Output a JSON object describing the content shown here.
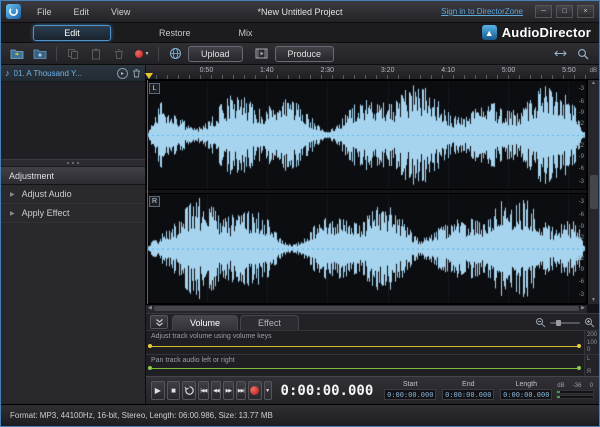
{
  "titlebar": {
    "menus": [
      "File",
      "Edit",
      "View"
    ],
    "title": "*New Untitled Project",
    "signin": "Sign in to DirectorZone"
  },
  "modes": {
    "edit": "Edit",
    "restore": "Restore",
    "mix": "Mix",
    "brand": "AudioDirector"
  },
  "toolbar": {
    "upload": "Upload",
    "produce": "Produce"
  },
  "library": {
    "track_label": "01. A Thousand Y..."
  },
  "adjustment": {
    "header": "Adjustment",
    "items": [
      {
        "label": "Adjust Audio"
      },
      {
        "label": "Apply Effect"
      }
    ]
  },
  "timeline": {
    "ticks": [
      "0:50",
      "1:40",
      "2:30",
      "3:20",
      "4:10",
      "5:00",
      "5:50"
    ],
    "db_unit": "dB",
    "channels": [
      {
        "label": "L"
      },
      {
        "label": "R"
      }
    ],
    "db_scale": [
      "-3",
      "-6",
      "-9",
      "-12",
      "-12",
      "-9",
      "-6",
      "-3"
    ]
  },
  "keyframe_panel": {
    "tabs": [
      {
        "label": "Volume"
      },
      {
        "label": "Effect"
      }
    ],
    "volume_hint": "Adjust track volume using volume keys",
    "pan_hint": "Pan track audio left or right",
    "volume_scale": [
      "200",
      "100",
      "0"
    ],
    "pan_scale": [
      "L",
      "R"
    ]
  },
  "transport": {
    "time": "0:00:00.000",
    "fields": [
      {
        "label": "Start",
        "value": "0:00:00.000"
      },
      {
        "label": "End",
        "value": "0:00:00.000"
      },
      {
        "label": "Length",
        "value": "0:00:00.000"
      }
    ],
    "meter": {
      "unit": "dB",
      "ticks": [
        "-36",
        "0"
      ]
    }
  },
  "statusbar": {
    "text": "Format: MP3, 44100Hz, 16-bit, Stereo, Length: 06:00.986, Size: 13.77 MB"
  },
  "icons": {
    "minimize": "─",
    "maximize": "□",
    "close": "×",
    "dropdown": "▼",
    "up_arrow": "▲",
    "note": "♪",
    "expand_arrow": "▶",
    "play": "▶",
    "stop": "■",
    "seek_start": "|◀◀",
    "rewind": "◀◀",
    "forward": "▶▶",
    "seek_end": "▶▶|",
    "scroll_up": "▲",
    "scroll_down": "▼",
    "scroll_left": "◀",
    "scroll_right": "▶",
    "track_badge": "▸"
  },
  "colors": {
    "accent": "#4e94cc",
    "waveform": "#a6d4ef",
    "volume_line": "#d8bc2e",
    "pan_line": "#7fb93c",
    "playhead": "#e03030",
    "record": "#c22020"
  }
}
